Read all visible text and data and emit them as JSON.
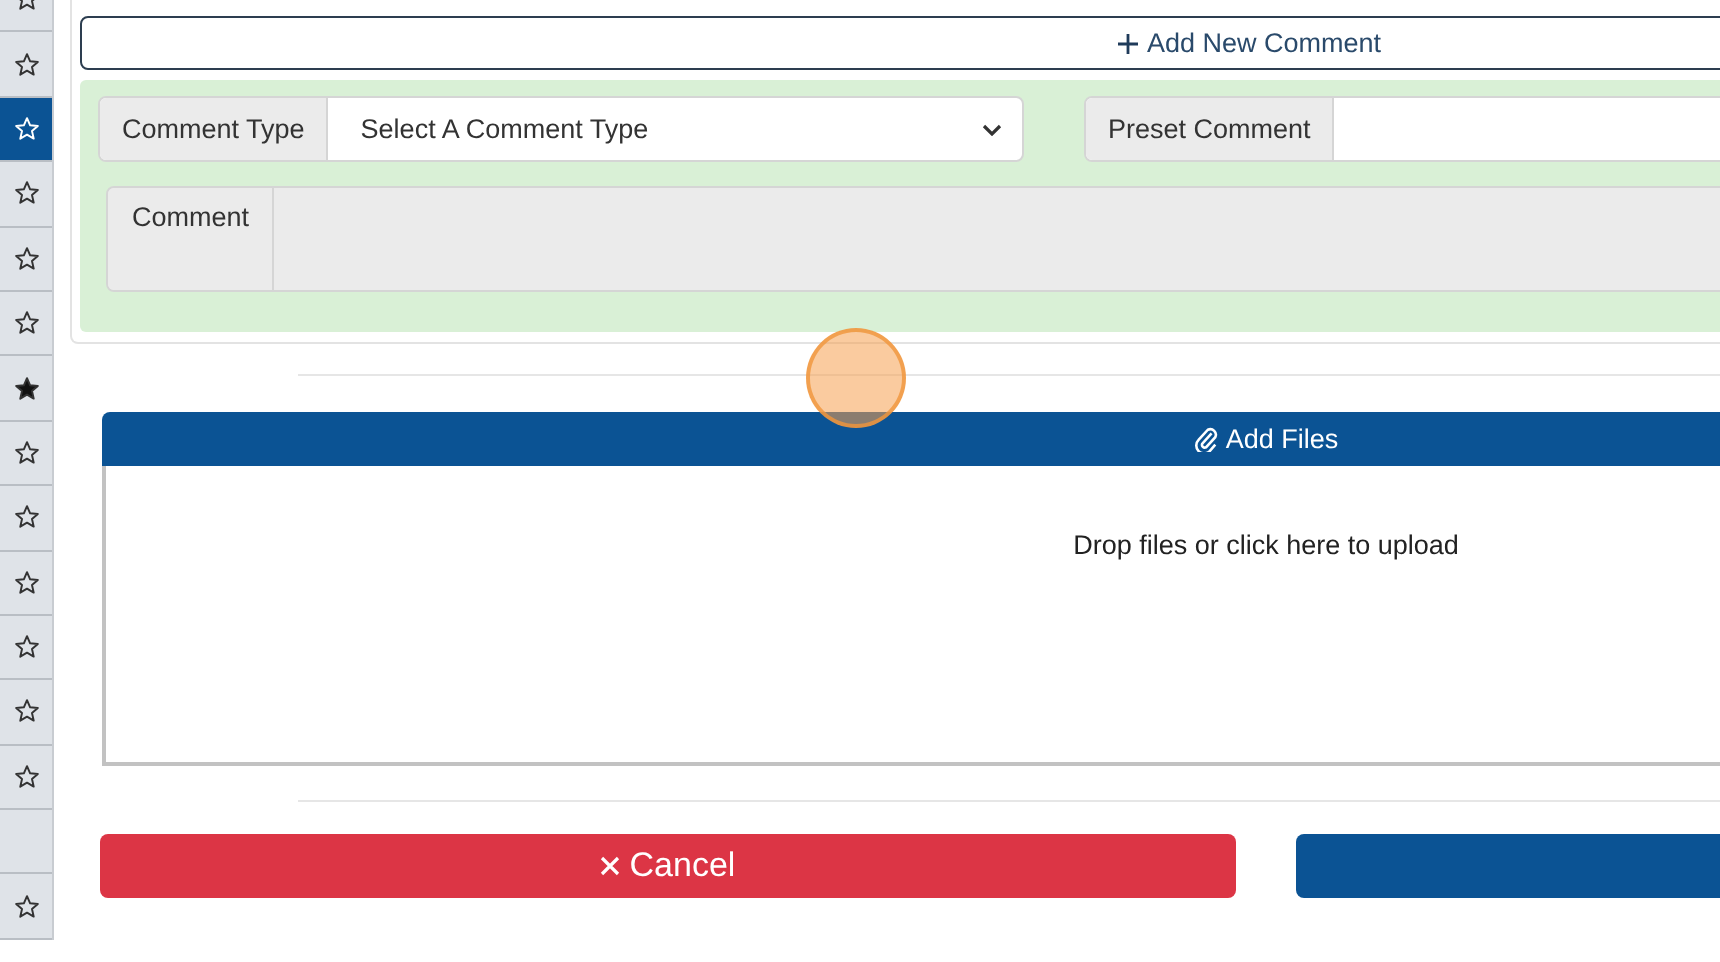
{
  "sidebar": {
    "items": [
      {
        "kind": "star",
        "filled": false,
        "selected": false
      },
      {
        "kind": "star",
        "filled": false,
        "selected": false
      },
      {
        "kind": "star",
        "filled": false,
        "selected": true
      },
      {
        "kind": "star",
        "filled": false,
        "selected": false
      },
      {
        "kind": "star",
        "filled": false,
        "selected": false
      },
      {
        "kind": "star",
        "filled": false,
        "selected": false
      },
      {
        "kind": "star",
        "filled": true,
        "selected": false
      },
      {
        "kind": "star",
        "filled": false,
        "selected": false
      },
      {
        "kind": "star",
        "filled": false,
        "selected": false
      },
      {
        "kind": "star",
        "filled": false,
        "selected": false
      },
      {
        "kind": "star",
        "filled": false,
        "selected": false
      },
      {
        "kind": "star",
        "filled": false,
        "selected": false
      },
      {
        "kind": "star",
        "filled": false,
        "selected": false
      },
      {
        "kind": "blank",
        "selected": false
      },
      {
        "kind": "star",
        "filled": false,
        "selected": false
      }
    ]
  },
  "comments": {
    "add_button": "Add New Comment",
    "comment_type": {
      "label": "Comment Type",
      "value": "Select A Comment Type"
    },
    "preset_comment": {
      "label": "Preset Comment"
    },
    "comment": {
      "label": "Comment"
    }
  },
  "attachments": {
    "header": "Add Files",
    "dropzone": "Drop files or click here to upload"
  },
  "buttons": {
    "cancel": "Cancel"
  }
}
